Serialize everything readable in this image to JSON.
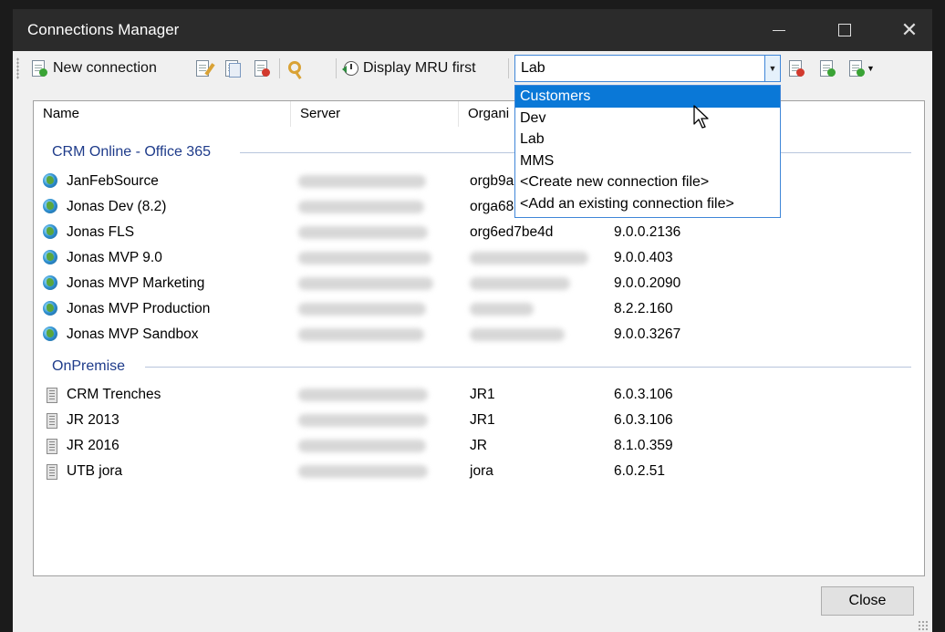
{
  "window": {
    "title": "Connections Manager"
  },
  "toolbar": {
    "new_connection_label": "New connection",
    "display_mru_label": "Display MRU first",
    "connection_file_value": "Lab"
  },
  "dropdown": {
    "options": [
      "Customers",
      "Dev",
      "Lab",
      "MMS",
      "<Create new connection file>",
      "<Add an existing connection file>"
    ],
    "highlighted": "Customers"
  },
  "columns": {
    "name": "Name",
    "server": "Server",
    "organization": "Organi"
  },
  "groups": [
    {
      "label": "CRM Online - Office 365",
      "rows": [
        {
          "name": "JanFebSource",
          "org": "orgb9a",
          "version": ""
        },
        {
          "name": "Jonas Dev (8.2)",
          "org": "orga68",
          "version": ""
        },
        {
          "name": "Jonas FLS",
          "org": "org6ed7be4d",
          "version": "9.0.0.2136"
        },
        {
          "name": "Jonas MVP 9.0",
          "org": "",
          "version": "9.0.0.403"
        },
        {
          "name": "Jonas MVP Marketing",
          "org": "",
          "version": "9.0.0.2090"
        },
        {
          "name": "Jonas MVP Production",
          "org": "",
          "version": "8.2.2.160"
        },
        {
          "name": "Jonas MVP Sandbox",
          "org": "",
          "version": "9.0.0.3267"
        }
      ]
    },
    {
      "label": "OnPremise",
      "rows": [
        {
          "name": "CRM Trenches",
          "org": "JR1",
          "version": "6.0.3.106"
        },
        {
          "name": "JR 2013",
          "org": "JR1",
          "version": "6.0.3.106"
        },
        {
          "name": "JR 2016",
          "org": "JR",
          "version": "8.1.0.359"
        },
        {
          "name": "UTB jora",
          "org": "jora",
          "version": "6.0.2.51"
        }
      ]
    }
  ],
  "buttons": {
    "close_label": "Close"
  },
  "colors": {
    "selection": "#0a78d7",
    "group_header": "#1e3b8a",
    "title_bar": "#2b2b2b"
  }
}
